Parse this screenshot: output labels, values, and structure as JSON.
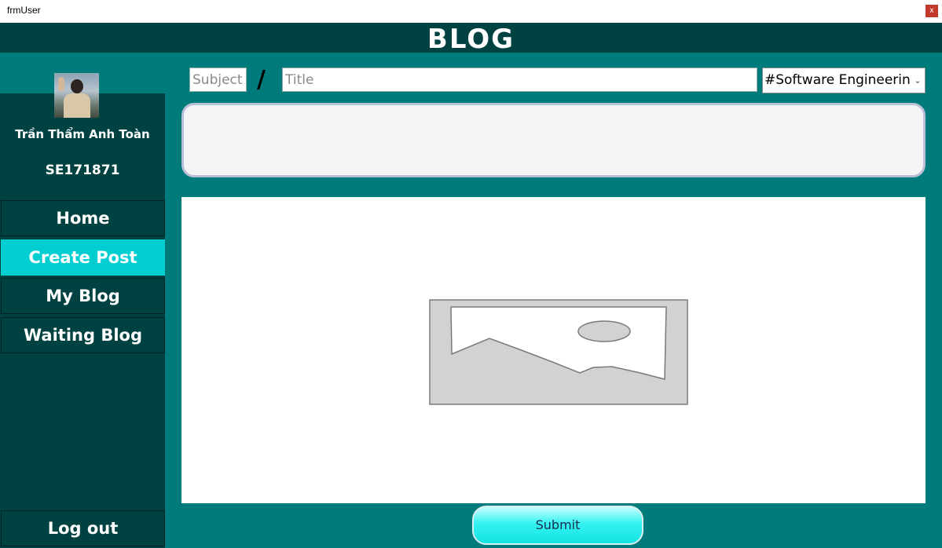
{
  "window": {
    "title": "frmUser",
    "close_label": "x"
  },
  "header": {
    "brand": "BLOG"
  },
  "profile": {
    "name": "Trần Thẩm Anh Toàn",
    "student_id": "SE171871"
  },
  "nav": {
    "items": [
      {
        "label": "Home",
        "active": false
      },
      {
        "label": "Create Post",
        "active": true
      },
      {
        "label": "My Blog",
        "active": false
      },
      {
        "label": "Waiting Blog",
        "active": false
      }
    ],
    "logout_label": "Log out"
  },
  "form": {
    "subject_placeholder": "Subject",
    "separator": "/",
    "title_placeholder": "Title",
    "category_selected": "#Software Engineering",
    "content_value": "",
    "image_placeholder_icon": "image-placeholder-icon",
    "submit_label": "Submit"
  },
  "colors": {
    "header_bg": "#004242",
    "body_bg": "#007b7b",
    "active_nav": "#00ced1",
    "submit_gradient_top": "#c6ffff",
    "submit_gradient_bottom": "#13e3e3"
  }
}
